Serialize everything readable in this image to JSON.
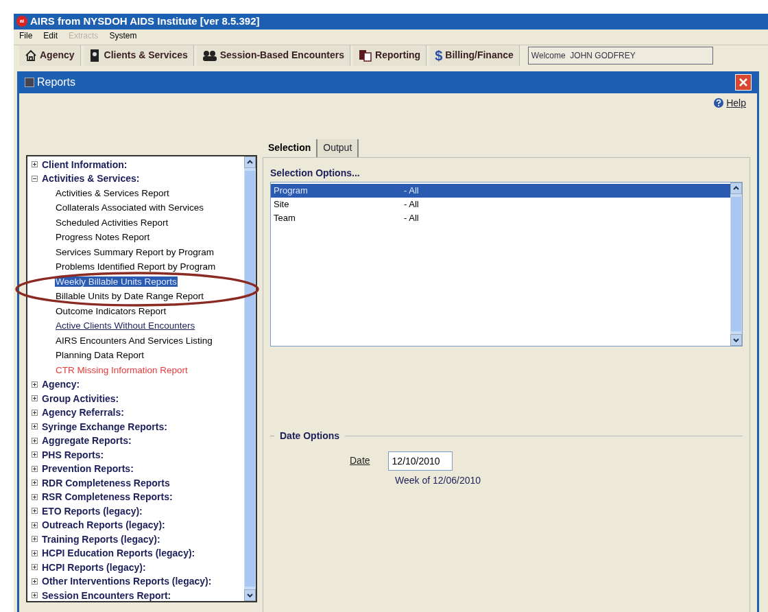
{
  "window": {
    "logo": "ai",
    "title": "AIRS from NYSDOH AIDS Institute [ver 8.5.392]"
  },
  "menu": [
    {
      "label": "File",
      "disabled": false
    },
    {
      "label": "Edit",
      "disabled": false
    },
    {
      "label": "Extracts",
      "disabled": true
    },
    {
      "label": "System",
      "disabled": false
    }
  ],
  "toolbar": [
    {
      "label": "Agency",
      "kind": "house"
    },
    {
      "label": "Clients & Services",
      "kind": "person"
    },
    {
      "label": "Session-Based Encounters",
      "kind": "group"
    },
    {
      "label": "Reporting",
      "kind": "report"
    },
    {
      "label": "Billing/Finance",
      "kind": "dollar",
      "glyph": "$"
    }
  ],
  "welcome": "Welcome  JOHN GODFREY",
  "reports_window": {
    "title": "Reports",
    "help": "Help"
  },
  "tree": [
    {
      "label": "Client Information:",
      "expanded": false
    },
    {
      "label": "Activities & Services:",
      "expanded": true,
      "children": [
        {
          "label": "Activities & Services Report",
          "selected": false,
          "underlined": false
        },
        {
          "label": "Collaterals Associated with Services",
          "selected": false,
          "underlined": false
        },
        {
          "label": "Scheduled Activities Report",
          "selected": false,
          "underlined": false
        },
        {
          "label": "Progress Notes Report",
          "selected": false,
          "underlined": false
        },
        {
          "label": "Services Summary Report by Program",
          "selected": false,
          "underlined": false
        },
        {
          "label": "Problems Identified Report by Program",
          "selected": false,
          "underlined": false
        },
        {
          "label": "Weekly Billable Units Reports",
          "selected": true,
          "underlined": false
        },
        {
          "label": "Billable Units by Date Range Report",
          "selected": false,
          "underlined": false
        },
        {
          "label": "Outcome Indicators Report",
          "selected": false,
          "underlined": false
        },
        {
          "label": "Active Clients Without Encounters",
          "selected": false,
          "underlined": true
        },
        {
          "label": "AIRS Encounters And Services Listing",
          "selected": false,
          "underlined": false
        },
        {
          "label": "Planning Data Report",
          "selected": false,
          "underlined": false
        },
        {
          "label": "CTR Missing Information Report",
          "selected": false,
          "underlined": false,
          "color": "#e83a3a"
        }
      ]
    },
    {
      "label": "Agency:",
      "expanded": false
    },
    {
      "label": "Group Activities:",
      "expanded": false
    },
    {
      "label": "Agency Referrals:",
      "expanded": false
    },
    {
      "label": "Syringe Exchange Reports:",
      "expanded": false
    },
    {
      "label": "Aggregate Reports:",
      "expanded": false
    },
    {
      "label": "PHS Reports:",
      "expanded": false
    },
    {
      "label": "Prevention Reports:",
      "expanded": false
    },
    {
      "label": "RDR Completeness Reports",
      "expanded": false
    },
    {
      "label": "RSR Completeness Reports:",
      "expanded": false
    },
    {
      "label": "ETO Reports (legacy):",
      "expanded": false
    },
    {
      "label": "Outreach Reports (legacy):",
      "expanded": false
    },
    {
      "label": "Training Reports (legacy):",
      "expanded": false
    },
    {
      "label": "HCPI Education Reports (legacy):",
      "expanded": false
    },
    {
      "label": "HCPI Reports (legacy):",
      "expanded": false
    },
    {
      "label": "Other Interventions Reports (legacy):",
      "expanded": false
    },
    {
      "label": "Session Encounters Report:",
      "expanded": false
    }
  ],
  "tabs": [
    {
      "label": "Selection",
      "selected": true
    },
    {
      "label": "Output",
      "selected": false
    }
  ],
  "selection_options": {
    "heading": "Selection Options...",
    "rows": [
      {
        "name": "Program",
        "value": "- All",
        "selected": true
      },
      {
        "name": "Site",
        "value": "- All",
        "selected": false
      },
      {
        "name": "Team",
        "value": "- All",
        "selected": false
      }
    ]
  },
  "date_options": {
    "heading": "Date Options",
    "label": "Date",
    "value": "12/10/2010",
    "note": "Week of 12/06/2010"
  }
}
